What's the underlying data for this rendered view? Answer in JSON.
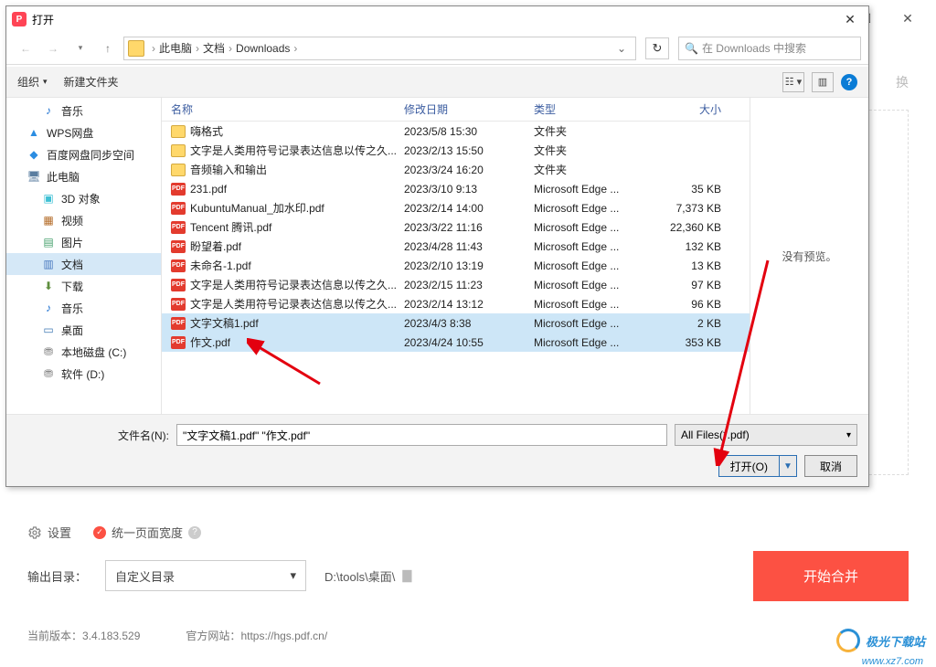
{
  "bg": {
    "min": "—",
    "max": "☐",
    "close": "✕",
    "settings_label": "设置",
    "uniform_label": "统一页面宽度",
    "out_label": "输出目录：",
    "out_mode": "自定义目录",
    "out_path": "D:\\tools\\桌面\\",
    "start": "开始合并",
    "version_label": "当前版本：",
    "version": "3.4.183.529",
    "site_label": "官方网站：",
    "site": "https://hgs.pdf.cn/"
  },
  "dialog": {
    "title": "打开",
    "breadcrumb": [
      "此电脑",
      "文档",
      "Downloads"
    ],
    "search_placeholder": "在 Downloads 中搜索",
    "organize": "组织",
    "new_folder": "新建文件夹",
    "preview_text": "没有预览。",
    "sidebar": [
      {
        "icon": "music",
        "label": "音乐",
        "sub": true
      },
      {
        "icon": "wps",
        "label": "WPS网盘"
      },
      {
        "icon": "baidu",
        "label": "百度网盘同步空间"
      },
      {
        "icon": "pc",
        "label": "此电脑"
      },
      {
        "icon": "3d",
        "label": "3D 对象",
        "sub": true
      },
      {
        "icon": "video",
        "label": "视频",
        "sub": true
      },
      {
        "icon": "pic",
        "label": "图片",
        "sub": true
      },
      {
        "icon": "doc",
        "label": "文档",
        "sub": true,
        "selected": true
      },
      {
        "icon": "dl",
        "label": "下载",
        "sub": true
      },
      {
        "icon": "music",
        "label": "音乐",
        "sub": true
      },
      {
        "icon": "desk",
        "label": "桌面",
        "sub": true
      },
      {
        "icon": "disk",
        "label": "本地磁盘 (C:)",
        "sub": true
      },
      {
        "icon": "disk",
        "label": "软件 (D:)",
        "sub": true
      }
    ],
    "columns": {
      "name": "名称",
      "date": "修改日期",
      "type": "类型",
      "size": "大小"
    },
    "rows": [
      {
        "kind": "folder",
        "name": "嗨格式",
        "date": "2023/5/8 15:30",
        "type": "文件夹",
        "size": ""
      },
      {
        "kind": "folder",
        "name": "文字是人类用符号记录表达信息以传之久...",
        "date": "2023/2/13 15:50",
        "type": "文件夹",
        "size": ""
      },
      {
        "kind": "folder",
        "name": "音频输入和输出",
        "date": "2023/3/24 16:20",
        "type": "文件夹",
        "size": ""
      },
      {
        "kind": "pdf",
        "name": "231.pdf",
        "date": "2023/3/10 9:13",
        "type": "Microsoft Edge ...",
        "size": "35 KB"
      },
      {
        "kind": "pdf",
        "name": "KubuntuManual_加水印.pdf",
        "date": "2023/2/14 14:00",
        "type": "Microsoft Edge ...",
        "size": "7,373 KB"
      },
      {
        "kind": "pdf",
        "name": "Tencent 腾讯.pdf",
        "date": "2023/3/22 11:16",
        "type": "Microsoft Edge ...",
        "size": "22,360 KB"
      },
      {
        "kind": "pdf",
        "name": "盼望着.pdf",
        "date": "2023/4/28 11:43",
        "type": "Microsoft Edge ...",
        "size": "132 KB"
      },
      {
        "kind": "pdf",
        "name": "未命名-1.pdf",
        "date": "2023/2/10 13:19",
        "type": "Microsoft Edge ...",
        "size": "13 KB"
      },
      {
        "kind": "pdf",
        "name": "文字是人类用符号记录表达信息以传之久...",
        "date": "2023/2/15 11:23",
        "type": "Microsoft Edge ...",
        "size": "97 KB"
      },
      {
        "kind": "pdf",
        "name": "文字是人类用符号记录表达信息以传之久...",
        "date": "2023/2/14 13:12",
        "type": "Microsoft Edge ...",
        "size": "96 KB"
      },
      {
        "kind": "pdf",
        "name": "文字文稿1.pdf",
        "date": "2023/4/3 8:38",
        "type": "Microsoft Edge ...",
        "size": "2 KB",
        "selected": true
      },
      {
        "kind": "pdf",
        "name": "作文.pdf",
        "date": "2023/4/24 10:55",
        "type": "Microsoft Edge ...",
        "size": "353 KB",
        "selected": true
      }
    ],
    "filename_label": "文件名(N):",
    "filename_value": "\"文字文稿1.pdf\" \"作文.pdf\"",
    "filter": "All Files(*.pdf)",
    "open_btn": "打开(O)",
    "cancel_btn": "取消"
  },
  "logo": {
    "text": "极光下载站",
    "url": "www.xz7.com"
  }
}
